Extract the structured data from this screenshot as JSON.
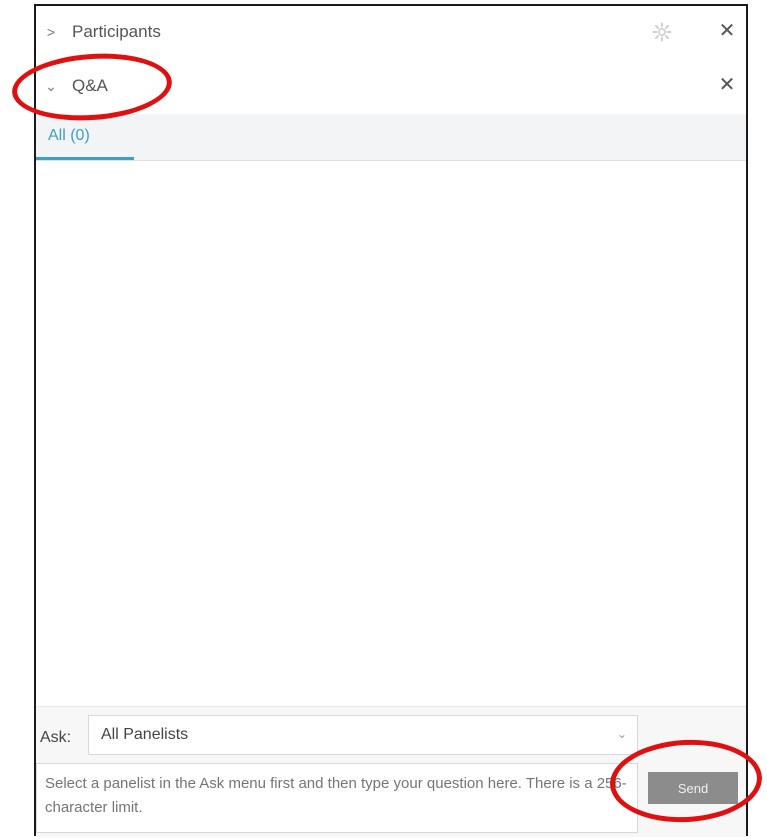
{
  "panel": {
    "participants": {
      "expand_icon": "chevron-right-icon",
      "chevron": ">",
      "title": "Participants",
      "settings_icon": "gear-icon",
      "close_icon": "close-icon",
      "close": "✕"
    },
    "qa": {
      "expand_icon": "chevron-down-icon",
      "chevron": "⌄",
      "title": "Q&A",
      "close_icon": "close-icon",
      "close": "✕"
    },
    "tabs": [
      {
        "label": "All (0)",
        "active": true
      }
    ]
  },
  "ask": {
    "label": "Ask:",
    "selected": "All Panelists",
    "caret": "⌄",
    "placeholder": "Select a panelist in the Ask menu first and then type your question here. There is a 256-character limit.",
    "send_label": "Send"
  },
  "colors": {
    "tab_accent": "#3aa0c8",
    "send_button": "#8c8c8c",
    "annotation": "#e01010"
  }
}
